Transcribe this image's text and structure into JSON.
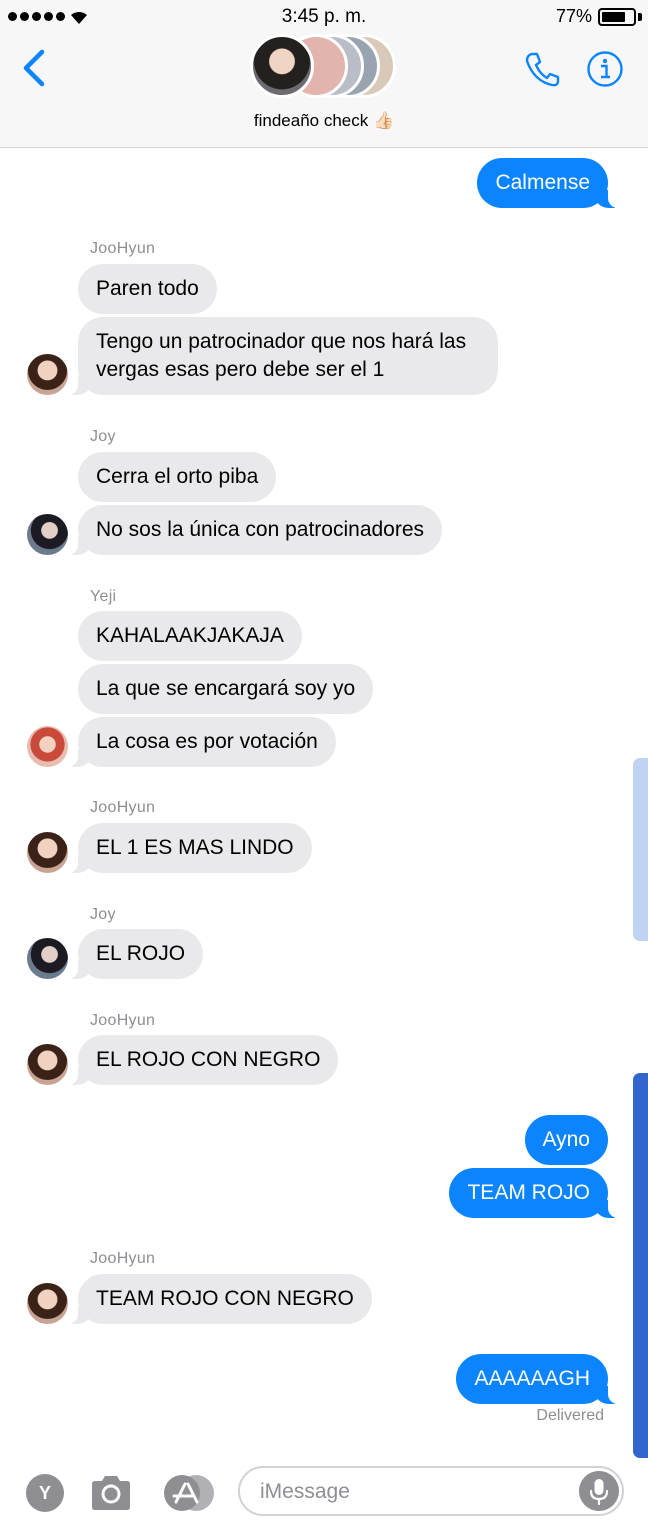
{
  "status_bar": {
    "time": "3:45 p. m.",
    "battery_percent": "77%",
    "battery_level": 0.77,
    "signal_bars": 5
  },
  "header": {
    "group_name": "findeaño check 👍🏻",
    "back_icon": "chevron-left-icon",
    "call_icon": "phone-icon",
    "info_icon": "info-icon",
    "accent_color": "#0b84fe"
  },
  "messages": [
    {
      "direction": "out",
      "text": "Calmense"
    },
    {
      "sender": "JooHyun",
      "direction": "in",
      "text": "Paren todo"
    },
    {
      "direction": "in",
      "text": "Tengo un patrocinador que nos hará las vergas esas pero debe ser el 1"
    },
    {
      "sender": "Joy",
      "direction": "in",
      "text": "Cerra el orto piba"
    },
    {
      "direction": "in",
      "text": "No sos la única con patrocinadores"
    },
    {
      "sender": "Yeji",
      "direction": "in",
      "text": "KAHALAAKJAKAJA"
    },
    {
      "direction": "in",
      "text": "La que se encargará soy yo"
    },
    {
      "direction": "in",
      "text": "La cosa es por votación"
    },
    {
      "sender": "JooHyun",
      "direction": "in",
      "text": "EL 1 ES MAS LINDO"
    },
    {
      "sender": "Joy",
      "direction": "in",
      "text": "EL ROJO"
    },
    {
      "sender": "JooHyun",
      "direction": "in",
      "text": "EL ROJO CON NEGRO"
    },
    {
      "direction": "out",
      "text": "Ayno"
    },
    {
      "direction": "out",
      "text": "TEAM ROJO"
    },
    {
      "sender": "JooHyun",
      "direction": "in",
      "text": "TEAM ROJO CON NEGRO"
    },
    {
      "direction": "out",
      "text": "AAAAAAGH"
    }
  ],
  "delivered_label": "Delivered",
  "input_bar": {
    "placeholder": "iMessage",
    "y_button_label": "Y",
    "camera_icon": "camera-icon",
    "apps_icon": "app-store-icon",
    "mic_icon": "microphone-icon"
  }
}
